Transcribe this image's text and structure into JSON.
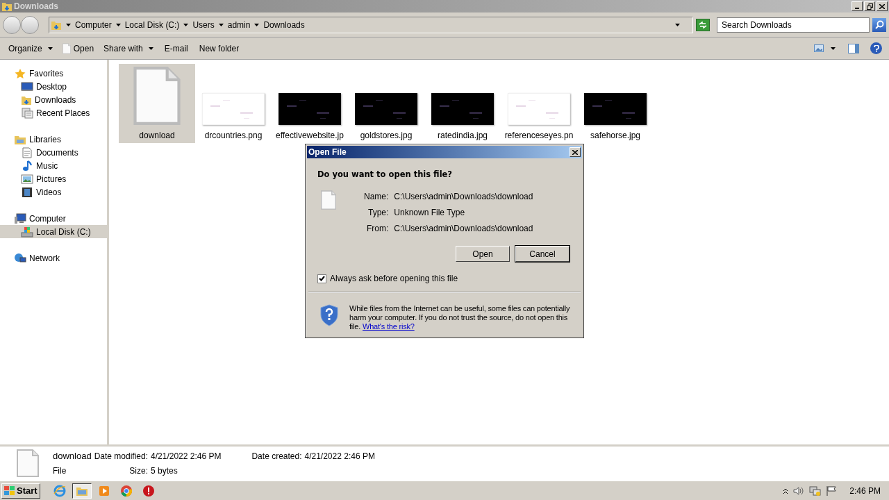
{
  "window": {
    "title": "Downloads"
  },
  "address": {
    "segments": [
      "Computer",
      "Local Disk (C:)",
      "Users",
      "admin",
      "Downloads"
    ]
  },
  "search": {
    "placeholder": "Search Downloads"
  },
  "toolbar": [
    {
      "label": "Organize",
      "kind": "menu"
    },
    {
      "label": "Open",
      "kind": "file"
    },
    {
      "label": "Share with",
      "kind": "menu"
    },
    {
      "label": "E-mail",
      "kind": "plain"
    },
    {
      "label": "New folder",
      "kind": "plain"
    }
  ],
  "sidebar": [
    {
      "label": "Favorites",
      "kind": "star",
      "selected": false,
      "children": [
        {
          "label": "Desktop",
          "kind": "desktop",
          "selected": false
        },
        {
          "label": "Downloads",
          "kind": "folder",
          "selected": false
        },
        {
          "label": "Recent Places",
          "kind": "recent",
          "selected": false
        }
      ]
    },
    {
      "label": "Libraries",
      "kind": "library",
      "selected": false,
      "children": [
        {
          "label": "Documents",
          "kind": "document",
          "selected": false
        },
        {
          "label": "Music",
          "kind": "music",
          "selected": false
        },
        {
          "label": "Pictures",
          "kind": "pictures",
          "selected": false
        },
        {
          "label": "Videos",
          "kind": "video",
          "selected": false
        }
      ]
    },
    {
      "label": "Computer",
      "kind": "computer",
      "selected": false,
      "children": [
        {
          "label": "Local Disk (C:)",
          "kind": "disk",
          "selected": true
        }
      ]
    },
    {
      "label": "Network",
      "kind": "network",
      "selected": false
    }
  ],
  "files": [
    {
      "name": "download",
      "kind": "document",
      "selected": true
    },
    {
      "name": "drcountries.png",
      "kind": "picture",
      "color": "#ffffff",
      "selected": false
    },
    {
      "name": "effectivewebsite.jp",
      "kind": "picture",
      "color": "#000000",
      "selected": false
    },
    {
      "name": "goldstores.jpg",
      "kind": "picture",
      "color": "#000000",
      "selected": false
    },
    {
      "name": "ratedindia.jpg",
      "kind": "picture",
      "color": "#000000",
      "selected": false
    },
    {
      "name": "referenceseyes.pn",
      "kind": "picture",
      "color": "#ffffff",
      "selected": false
    },
    {
      "name": "safehorse.jpg",
      "kind": "picture",
      "color": "#000000",
      "selected": false
    }
  ],
  "dialog": {
    "title": "Open File",
    "question": "Do you want to open this file?",
    "fields": [
      {
        "label": "Name:",
        "value": "C:\\Users\\admin\\Downloads\\download"
      },
      {
        "label": "Type:",
        "value": "Unknown File Type"
      },
      {
        "label": "From:",
        "value": "C:\\Users\\admin\\Downloads\\download"
      }
    ],
    "buttons": [
      {
        "label": "Open",
        "default": false
      },
      {
        "label": "Cancel",
        "default": true
      }
    ],
    "checkbox": {
      "label": "Always ask before opening this file",
      "checked": true
    },
    "warning": {
      "text": "While files from the Internet can be useful, some files can potentially harm your computer. If you do not trust the source, do not open this file.",
      "link": "What's the risk?"
    }
  },
  "details": {
    "name": "download",
    "type": "File",
    "fields": [
      {
        "label": "Date modified:",
        "value": "4/21/2022 2:46 PM"
      },
      {
        "label": "Size:",
        "value": "5 bytes"
      },
      {
        "label": "Date created:",
        "value": "4/21/2022 2:46 PM"
      }
    ]
  },
  "taskbar": {
    "start": "Start",
    "apps": [
      {
        "kind": "ie",
        "selected": false
      },
      {
        "kind": "explorer",
        "selected": true
      },
      {
        "kind": "media",
        "selected": false
      },
      {
        "kind": "chrome",
        "selected": false
      },
      {
        "kind": "stop",
        "selected": false
      }
    ],
    "clock": "2:46 PM"
  }
}
